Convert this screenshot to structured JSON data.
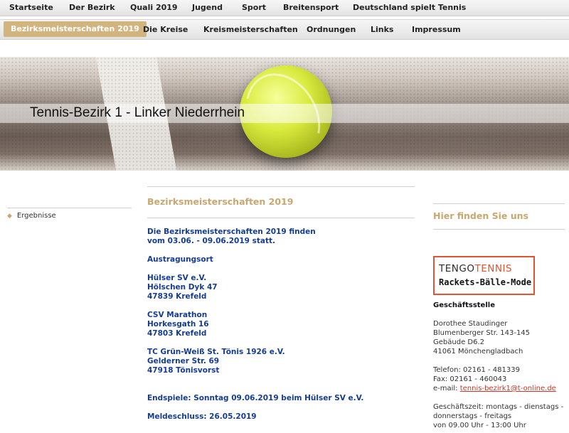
{
  "nav_top": [
    "Startseite",
    "Der Bezirk",
    "Quali 2019",
    "Jugend",
    "Sport",
    "Breitensport",
    "Deutschland spielt Tennis"
  ],
  "nav_sub": [
    "Bezirksmeisterschaften 2019",
    "Die Kreise",
    "Kreismeisterschaften",
    "Ordnungen",
    "Links",
    "Impressum"
  ],
  "banner": {
    "title": "Tennis-Bezirk 1 - Linker Niederrhein"
  },
  "left_nav": {
    "items": [
      "Ergebnisse"
    ]
  },
  "main": {
    "heading": "Bezirksmeisterschaften 2019",
    "lines": [
      "Die Bezirksmeisterschaften 2019 finden",
      "vom 03.06. - 09.06.2019 statt.",
      "",
      "Austragungsort",
      "",
      "Hülser SV e.V.",
      "Hölschen Dyk 47",
      "47839 Krefeld",
      "",
      "CSV Marathon",
      "Horkesgath 16",
      "47803 Krefeld",
      "",
      "TC Grün-Weiß St. Tönis 1926 e.V.",
      "Gelderner Str. 69",
      "47918 Tönisvorst",
      "",
      "",
      "Endspiele: Sonntag 09.06.2019 beim Hülser SV e.V.",
      "",
      "Meldeschluss: 26.05.2019"
    ]
  },
  "right": {
    "heading": "Hier finden Sie uns",
    "ad": {
      "brand_a": "TENGO",
      "brand_b": "TENNIS",
      "tagline": "Rackets-Bälle-Mode"
    },
    "office_heading": "Geschäftsstelle",
    "address_lines": [
      "Dorothee Staudinger",
      "Blumenberger Str. 143-145",
      "Gebäude D6.2",
      "41061 Mönchengladbach",
      "",
      "Telefon: 02161 - 481339",
      "Fax: 02161 - 460043"
    ],
    "email_label": "e-mail: ",
    "email": "tennis-bezirk1@t-online.de",
    "hours_lines": [
      "",
      "Geschäftszeit: montags - dienstags -",
      "donnerstags - freitags",
      "von 09.00 Uhr - 13:00 Uhr"
    ]
  },
  "colors": {
    "accent": "#d2b47f",
    "heading": "#c8a870",
    "content_blue": "#143d92",
    "ad_border": "#e05530",
    "link": "#c0392b"
  }
}
